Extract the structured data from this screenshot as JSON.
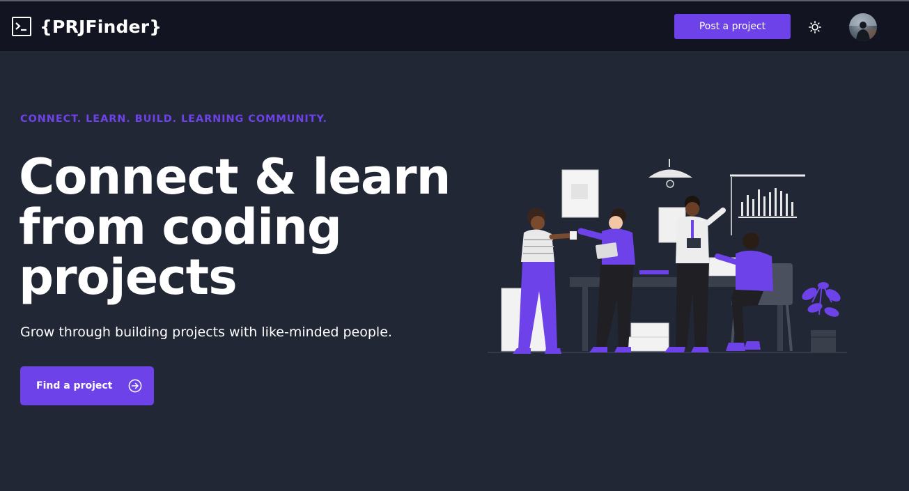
{
  "header": {
    "logo_text": "{PRJFinder}",
    "post_button_label": "Post a project",
    "theme_toggle_icon": "sun-icon",
    "avatar_icon": "user-avatar"
  },
  "hero": {
    "tagline": "CONNECT. LEARN. BUILD. LEARNING COMMUNITY.",
    "headline": "Connect & learn from coding projects",
    "subtitle": "Grow through building projects with like-minded people.",
    "cta_label": "Find a project",
    "cta_icon": "arrow-right-circle-icon",
    "illustration_icon": "team-collaboration-illustration"
  },
  "colors": {
    "accent": "#6d42e8",
    "navbar_bg": "#121521",
    "page_bg": "#222735",
    "text": "#ffffff"
  }
}
